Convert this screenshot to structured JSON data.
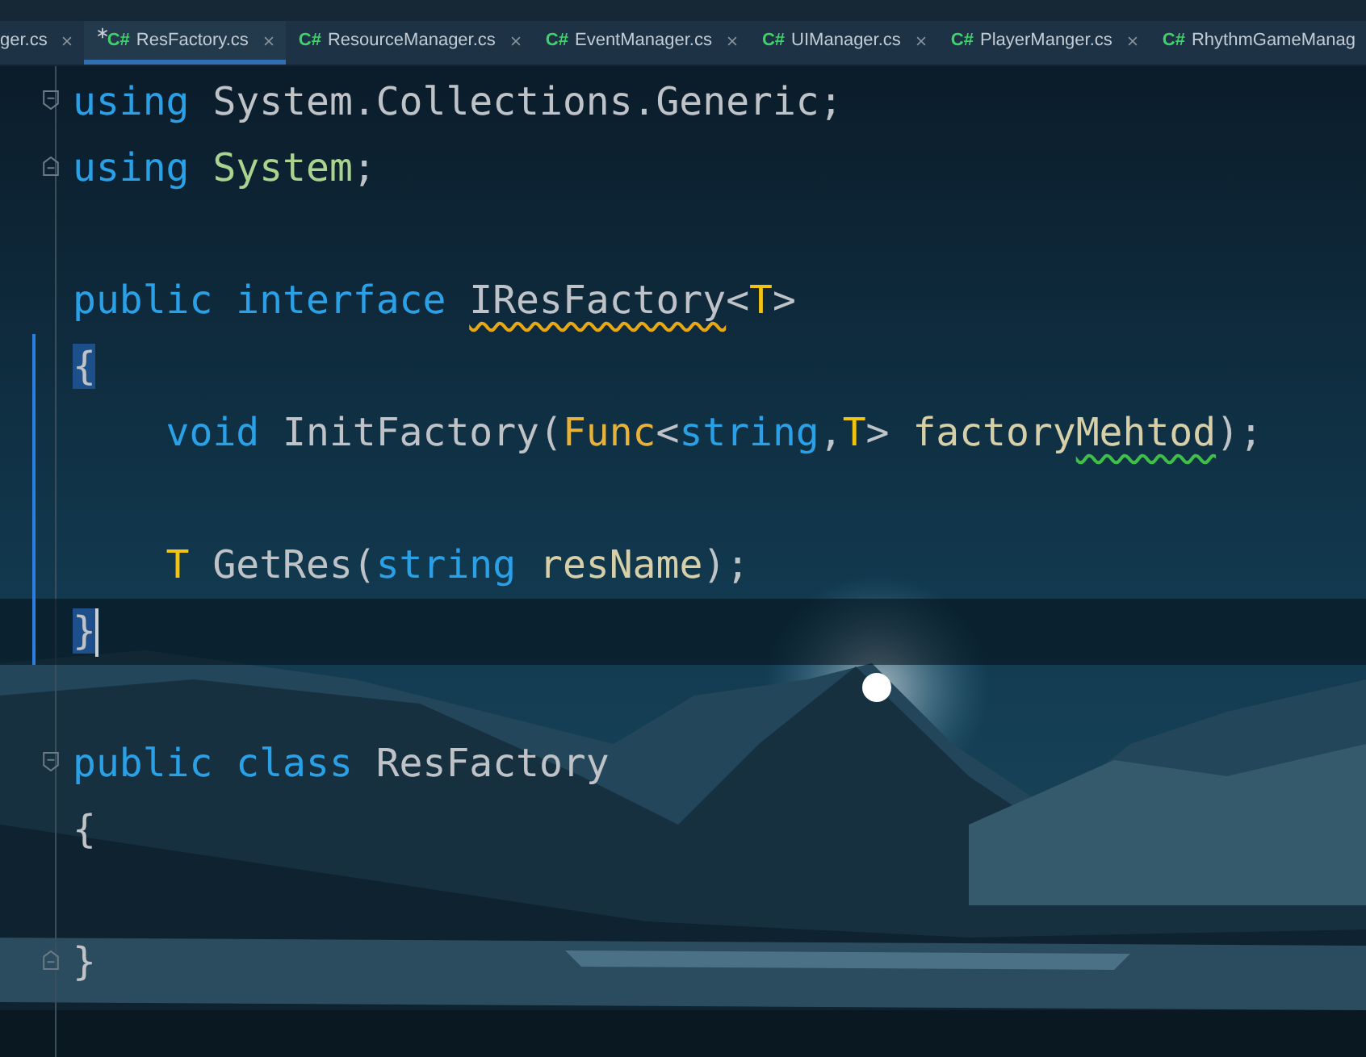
{
  "tabs": [
    {
      "label": "ger.cs",
      "selected": false,
      "modified": false,
      "closable": true
    },
    {
      "badge": "C#",
      "label": "ResFactory.cs",
      "selected": true,
      "modified": true,
      "closable": true
    },
    {
      "badge": "C#",
      "label": "ResourceManager.cs",
      "selected": false,
      "modified": false,
      "closable": true
    },
    {
      "badge": "C#",
      "label": "EventManager.cs",
      "selected": false,
      "modified": false,
      "closable": true
    },
    {
      "badge": "C#",
      "label": "UIManager.cs",
      "selected": false,
      "modified": false,
      "closable": true
    },
    {
      "badge": "C#",
      "label": "PlayerManger.cs",
      "selected": false,
      "modified": false,
      "closable": true
    },
    {
      "badge": "C#",
      "label": "RhythmGameManag",
      "selected": false,
      "modified": false,
      "closable": false
    }
  ],
  "editor": {
    "lines": [
      {
        "fold_open": true,
        "tokens": [
          {
            "text": "using",
            "kind": "keyword"
          },
          {
            "text": " System.Collections.Generic;",
            "kind": "plain"
          }
        ]
      },
      {
        "fold_close": true,
        "space_after": true,
        "tokens": [
          {
            "text": "using",
            "kind": "keyword"
          },
          {
            "text": " System",
            "kind": "namespace"
          },
          {
            "text": ";",
            "kind": "plain"
          }
        ]
      },
      {
        "tokens": [
          {
            "text": "public interface ",
            "kind": "keyword"
          },
          {
            "text": "IResFactory",
            "kind": "plain",
            "warning": true
          },
          {
            "text": "<",
            "kind": "plain"
          },
          {
            "text": "T",
            "kind": "typeparam"
          },
          {
            "text": ">",
            "kind": "plain"
          }
        ]
      },
      {
        "changed": true,
        "tokens": [
          {
            "text": "{",
            "kind": "plain",
            "matched": true
          }
        ]
      },
      {
        "changed": true,
        "space_after": true,
        "tokens": [
          {
            "text": "    void",
            "kind": "keyword"
          },
          {
            "text": " InitFactory(",
            "kind": "plain"
          },
          {
            "text": "Func",
            "kind": "type"
          },
          {
            "text": "<",
            "kind": "plain"
          },
          {
            "text": "string",
            "kind": "keyword"
          },
          {
            "text": ",",
            "kind": "plain"
          },
          {
            "text": "T",
            "kind": "typeparam"
          },
          {
            "text": "> ",
            "kind": "plain"
          },
          {
            "text": "factory",
            "kind": "param"
          },
          {
            "text": "Mehtod",
            "kind": "param",
            "misspelled": true
          },
          {
            "text": ");",
            "kind": "plain"
          }
        ]
      },
      {
        "changed": true,
        "tokens": [
          {
            "text": "    T",
            "kind": "typeparam"
          },
          {
            "text": " GetRes(",
            "kind": "plain"
          },
          {
            "text": "string",
            "kind": "keyword"
          },
          {
            "text": " resName",
            "kind": "param"
          },
          {
            "text": ");",
            "kind": "plain"
          }
        ]
      },
      {
        "changed": true,
        "current": true,
        "caret": true,
        "space_after": true,
        "tokens": [
          {
            "text": "}",
            "kind": "plain",
            "matched": true
          }
        ]
      },
      {
        "fold_open": true,
        "tokens": [
          {
            "text": "public class",
            "kind": "keyword"
          },
          {
            "text": " ResFactory",
            "kind": "plain"
          }
        ]
      },
      {
        "space_after": true,
        "tokens": [
          {
            "text": "{",
            "kind": "plain"
          }
        ]
      },
      {
        "fold_close": true,
        "tokens": [
          {
            "text": "}",
            "kind": "plain"
          }
        ]
      }
    ]
  }
}
